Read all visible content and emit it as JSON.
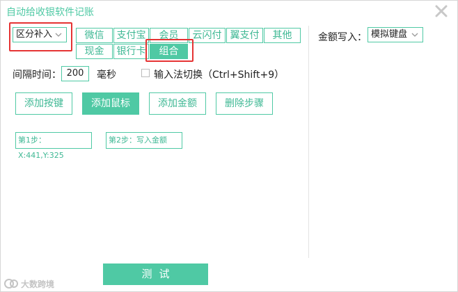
{
  "window": {
    "title": "自动给收银软件记账"
  },
  "mode_select": {
    "value": "区分补入"
  },
  "payment_buttons": [
    {
      "label": "微信"
    },
    {
      "label": "支付宝"
    },
    {
      "label": "会员"
    },
    {
      "label": "云闪付"
    },
    {
      "label": "翼支付"
    },
    {
      "label": "其他"
    },
    {
      "label": "现金"
    },
    {
      "label": "银行卡"
    },
    {
      "label": "组合",
      "active": true
    }
  ],
  "interval": {
    "label": "间隔时间：",
    "value": "200",
    "unit": "毫秒"
  },
  "ime_switch": {
    "label": "输入法切换（Ctrl+Shift+9）",
    "checked": false
  },
  "actions": {
    "add_key": "添加按键",
    "add_mouse": "添加鼠标",
    "add_amount": "添加金额",
    "delete_step": "删除步骤"
  },
  "steps": [
    {
      "label": "第1步：X:441,Y:325"
    },
    {
      "label": "第2步：写入金额"
    }
  ],
  "amount_write": {
    "label": "金额写入：",
    "value": "模拟键盘"
  },
  "test_button": {
    "label": "测试"
  },
  "watermark": {
    "text": "大数跨境"
  },
  "colors": {
    "accent": "#4fc9a4",
    "highlight": "#e53333"
  }
}
